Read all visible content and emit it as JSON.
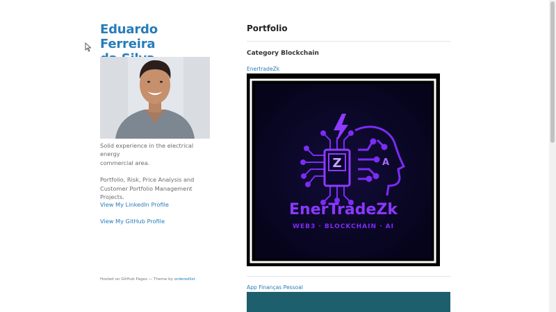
{
  "sidebar": {
    "title_line1": "Eduardo Ferreira",
    "title_line2": "da Silva",
    "avatar_alt": "profile-photo",
    "description1_line1": "Solid experience in the electrical energy",
    "description1_line2": "commercial area.",
    "description2_line1": "Portfolio, Risk, Price Analysis and",
    "description2_line2": "Customer Portfolio Management",
    "description2_line3": "Projects.",
    "linkedin_label": "View My LinkedIn Profile",
    "github_label": "View My GitHub Profile",
    "footer_text": "Hosted on GitHub Pages — Theme by ",
    "footer_link": "orderedlist"
  },
  "main": {
    "heading": "Portfolio",
    "category_heading": "Category Blockchain",
    "project1": {
      "link_label": "EnertradeZk",
      "logo_letter": "Z",
      "logo_side_letter": "A",
      "logo_title": "EnerTradeZk",
      "logo_subtitle": "WEB3 · BLOCKCHAIN · AI"
    },
    "project2": {
      "link_label": "App Finanças Pessoal"
    }
  },
  "colors": {
    "link": "#267CB9",
    "logo_purple": "#7b2cf5",
    "logo_background": "#07051a",
    "teal_banner": "#1e5f6e"
  },
  "icons": {
    "cursor": "mouse-pointer-icon",
    "bolt": "lightning-bolt-icon",
    "chip": "circuit-chip-icon",
    "head": "ai-head-icon"
  }
}
